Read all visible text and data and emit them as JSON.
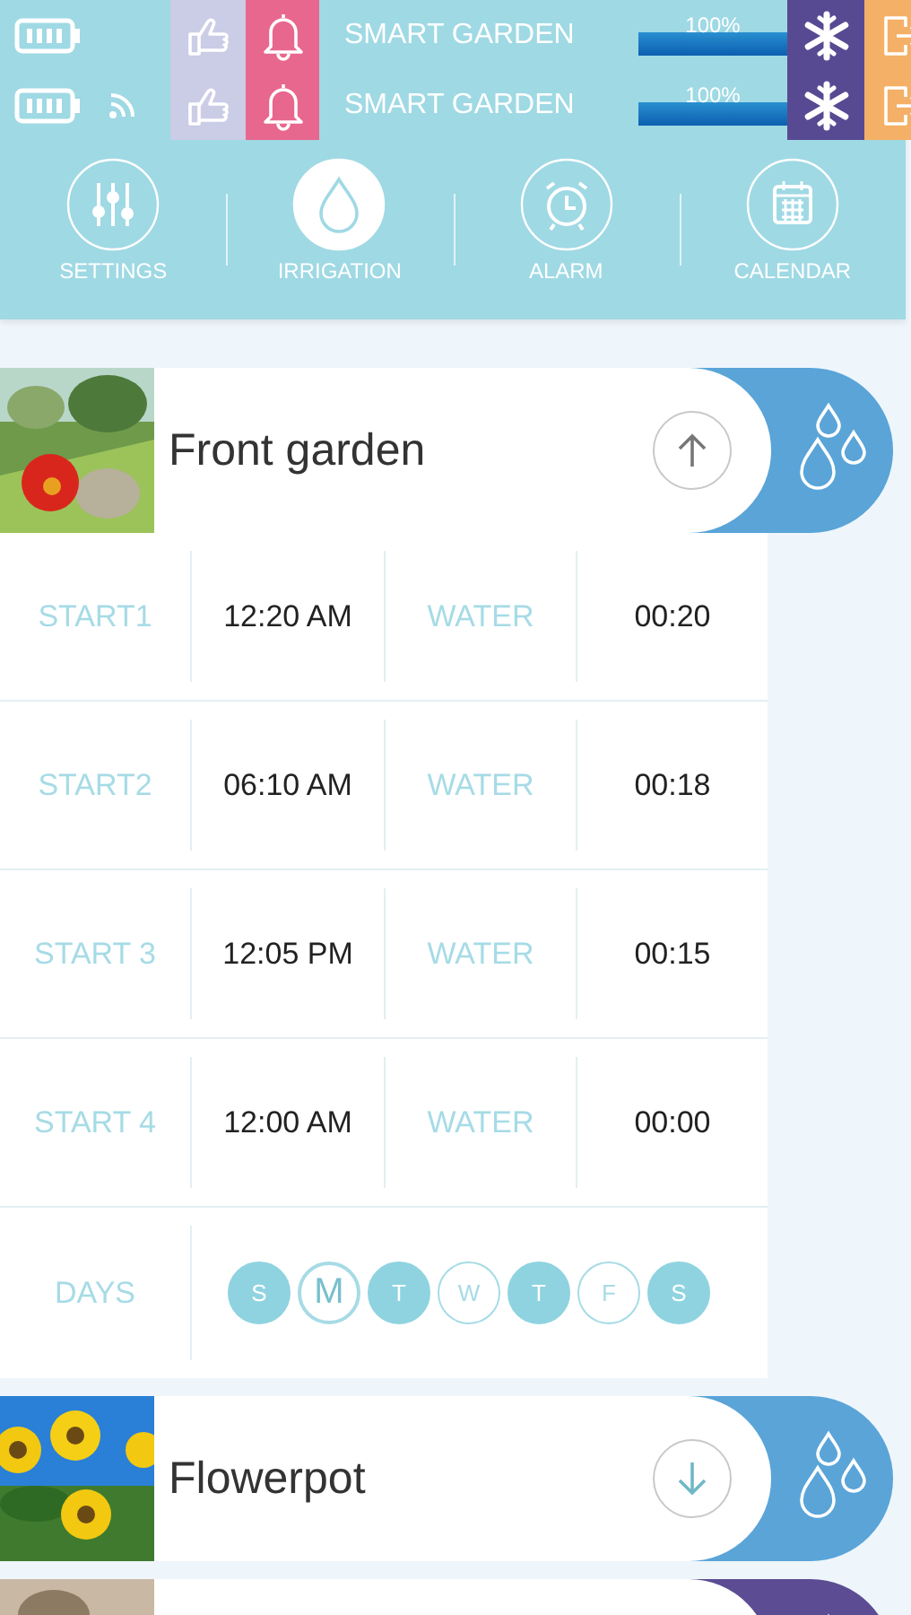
{
  "status_rows": [
    {
      "signal": false,
      "title": "SMART GARDEN",
      "level": 1,
      "reading": "100%"
    },
    {
      "signal": true,
      "title": "SMART GARDEN",
      "level": 1,
      "reading": "100%"
    }
  ],
  "nav": [
    {
      "kind": "sliders",
      "label": "SETTINGS",
      "selected": false
    },
    {
      "kind": "drop",
      "label": "IRRIGATION",
      "selected": true
    },
    {
      "kind": "alarm",
      "label": "ALARM",
      "selected": false
    },
    {
      "kind": "calendar",
      "label": "CALENDAR",
      "selected": false
    }
  ],
  "zones": [
    {
      "name": "Front garden",
      "expanded": true,
      "color": "#5aa4d8",
      "schedule": [
        {
          "label": "START1",
          "time": "12:20 AM",
          "water_label": "WATER",
          "duration": "00:20"
        },
        {
          "label": "START2",
          "time": "06:10 AM",
          "water_label": "WATER",
          "duration": "00:18"
        },
        {
          "label": "START 3",
          "time": "12:05 PM",
          "water_label": "WATER",
          "duration": "00:15"
        },
        {
          "label": "START 4",
          "time": "12:00 AM",
          "water_label": "WATER",
          "duration": "00:00"
        }
      ],
      "days": {
        "label": "DAYS",
        "items": [
          {
            "letter": "S",
            "selected": true,
            "today": false
          },
          {
            "letter": "M",
            "selected": false,
            "today": true
          },
          {
            "letter": "T",
            "selected": true,
            "today": false
          },
          {
            "letter": "W",
            "selected": false,
            "today": false
          },
          {
            "letter": "T",
            "selected": true,
            "today": false
          },
          {
            "letter": "F",
            "selected": false,
            "today": false
          },
          {
            "letter": "S",
            "selected": true,
            "today": false
          }
        ]
      }
    },
    {
      "name": "Flowerpot",
      "expanded": false,
      "color": "#5aa4d8"
    },
    {
      "color": "#5b4c94"
    }
  ]
}
